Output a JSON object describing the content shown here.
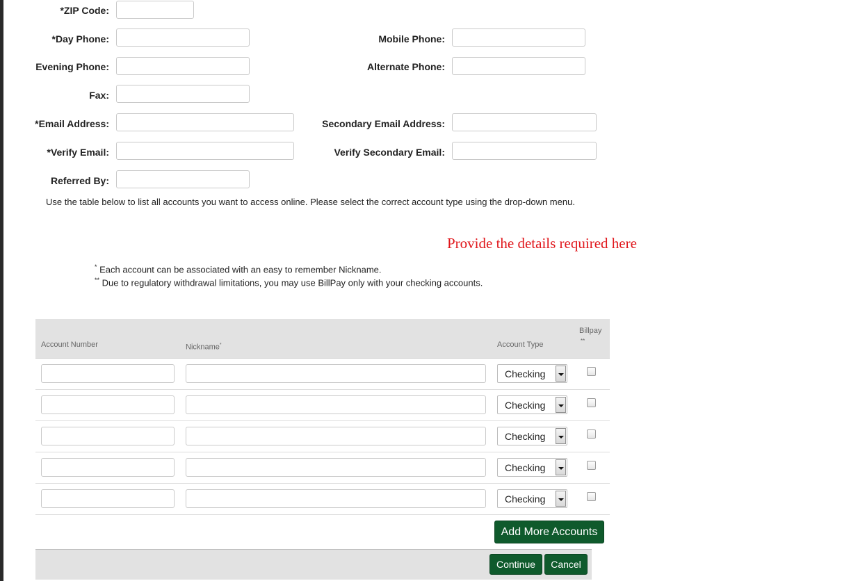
{
  "form": {
    "zip_label": "*ZIP Code:",
    "day_phone_label": "*Day Phone:",
    "mobile_phone_label": "Mobile Phone:",
    "evening_phone_label": "Evening Phone:",
    "alternate_phone_label": "Alternate Phone:",
    "fax_label": "Fax:",
    "email_label": "*Email Address:",
    "secondary_email_label": "Secondary Email Address:",
    "verify_email_label": "*Verify Email:",
    "verify_secondary_email_label": "Verify Secondary Email:",
    "referred_by_label": "Referred By:"
  },
  "instructions": "Use the table below to list all accounts you want to access online. Please select the correct account type using the drop-down menu.",
  "annotation": "Provide the details required here",
  "notes": {
    "note1_marker": "*",
    "note1": " Each account can be associated with an easy to remember Nickname.",
    "note2_marker": "**",
    "note2": " Due to regulatory withdrawal limitations, you may use BillPay only with your checking accounts."
  },
  "table": {
    "headers": {
      "account_number": "Account Number",
      "nickname": "Nickname",
      "nickname_marker": "*",
      "account_type": "Account Type",
      "billpay": "Billpay",
      "billpay_marker": "**"
    },
    "rows": [
      {
        "account_number": "",
        "nickname": "",
        "account_type": "Checking",
        "billpay": false
      },
      {
        "account_number": "",
        "nickname": "",
        "account_type": "Checking",
        "billpay": false
      },
      {
        "account_number": "",
        "nickname": "",
        "account_type": "Checking",
        "billpay": false
      },
      {
        "account_number": "",
        "nickname": "",
        "account_type": "Checking",
        "billpay": false
      },
      {
        "account_number": "",
        "nickname": "",
        "account_type": "Checking",
        "billpay": false
      }
    ]
  },
  "buttons": {
    "add_more": "Add More Accounts",
    "continue": "Continue",
    "cancel": "Cancel"
  },
  "colors": {
    "button_green": "#0f5a2c",
    "annotation_red": "#e0161b",
    "table_header_bg": "#e2e2e2"
  }
}
